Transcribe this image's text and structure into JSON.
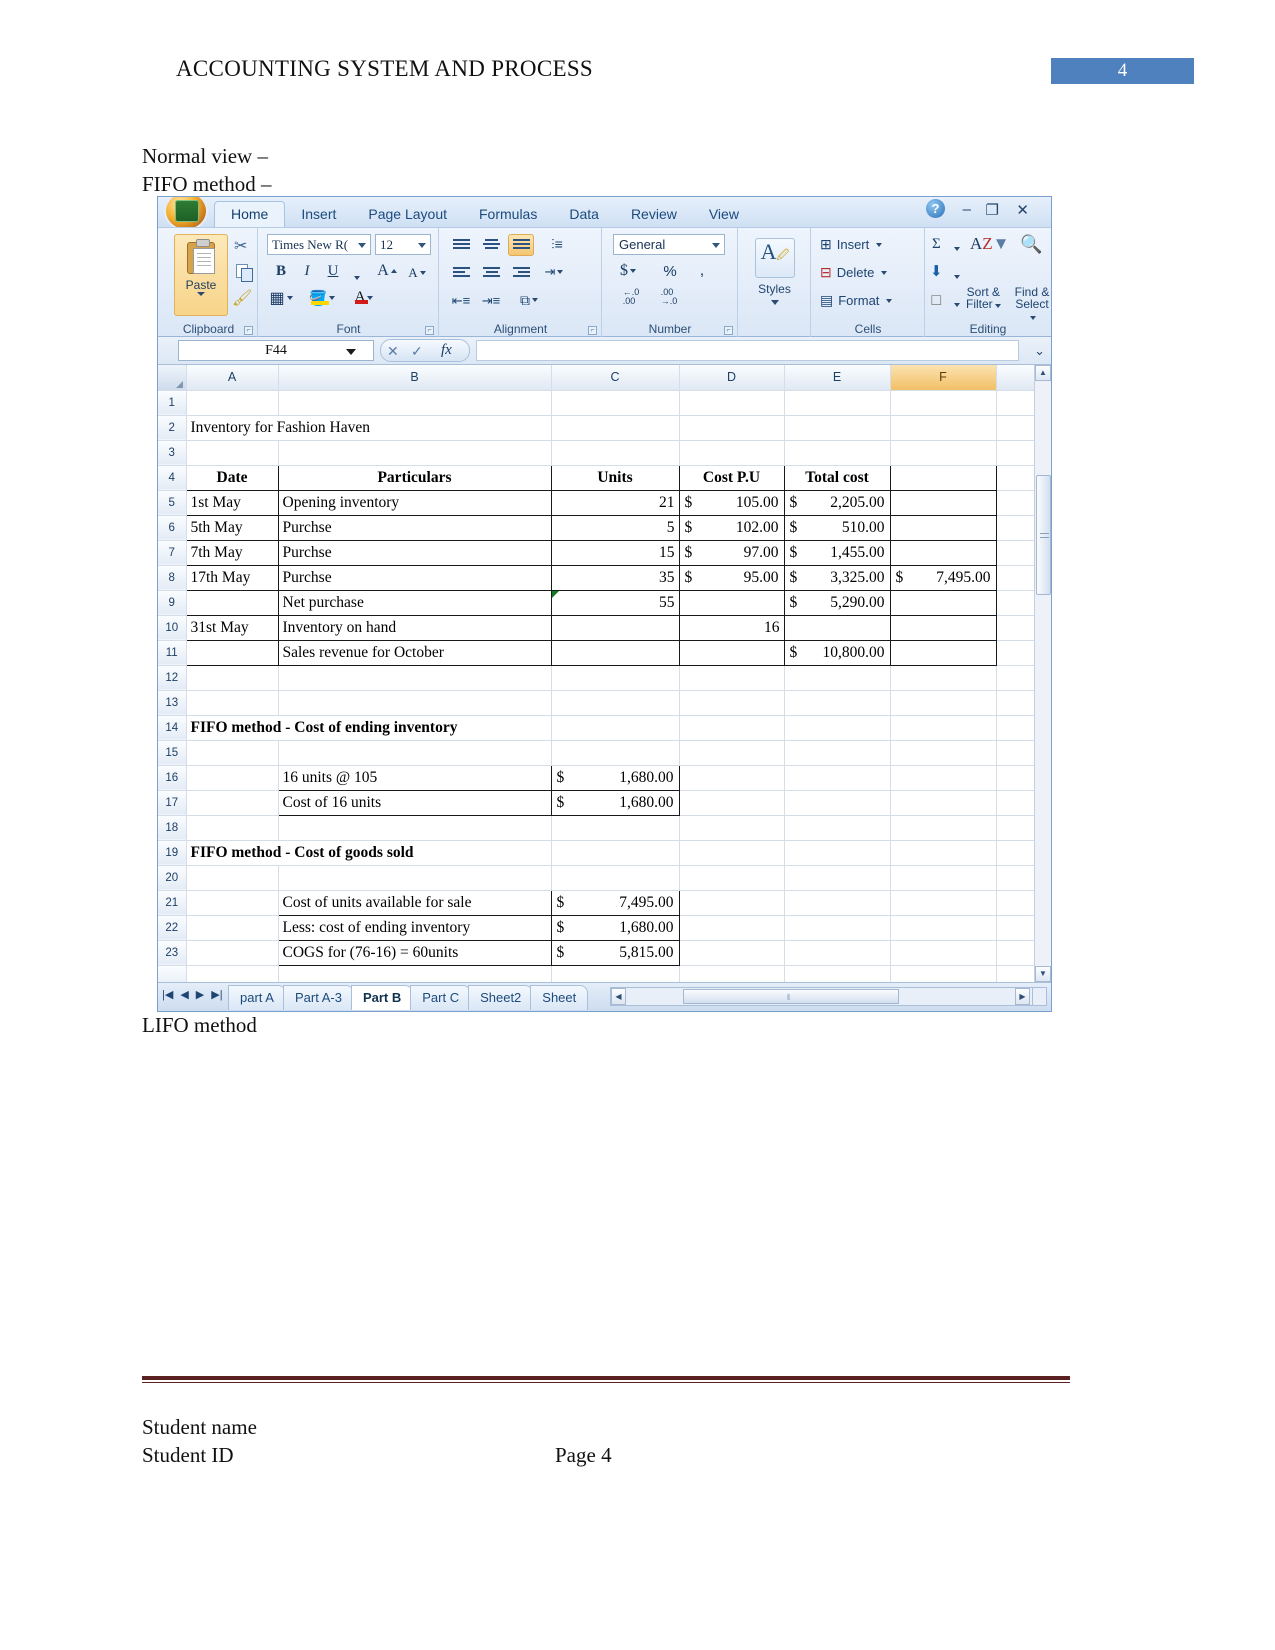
{
  "header": {
    "title": "ACCOUNTING SYSTEM AND PROCESS",
    "page_number": "4",
    "page_number_bg": "#4E81BD"
  },
  "body": {
    "caption_1": "Normal view –",
    "caption_2": "FIFO method –",
    "caption_3": "LIFO method"
  },
  "excel": {
    "ribbon_tabs": [
      {
        "label": "Home",
        "active": true
      },
      {
        "label": "Insert",
        "active": false
      },
      {
        "label": "Page Layout",
        "active": false
      },
      {
        "label": "Formulas",
        "active": false
      },
      {
        "label": "Data",
        "active": false
      },
      {
        "label": "Review",
        "active": false
      },
      {
        "label": "View",
        "active": false
      }
    ],
    "window_controls": {
      "help": "?",
      "minimize": "–",
      "maximize": "❐",
      "close": "✕"
    },
    "groups": {
      "clipboard": {
        "label": "Clipboard",
        "paste": "Paste",
        "cut": "✂",
        "copy": "copy",
        "format_painter": "format-painter"
      },
      "font": {
        "label": "Font",
        "font_name": "Times New R(",
        "font_size": "12",
        "bold": "B",
        "italic": "I",
        "underline": "U",
        "grow_font": "A",
        "shrink_font": "A"
      },
      "alignment": {
        "label": "Alignment"
      },
      "number": {
        "label": "Number",
        "format": "General",
        "currency": "$",
        "percent": "%",
        "comma": ",",
        "increase_decimal": ".00",
        "decrease_decimal": ".0"
      },
      "styles": {
        "label": "Styles",
        "button": "Styles"
      },
      "cells": {
        "label": "Cells",
        "insert": "Insert",
        "delete": "Delete",
        "format": "Format"
      },
      "editing": {
        "label": "Editing",
        "autosum": "Σ",
        "sort_filter": "Sort &\nFilter",
        "sort_filter_l1": "Sort &",
        "sort_filter_l2": "Filter",
        "find_select_l1": "Find &",
        "find_select_l2": "Select"
      }
    },
    "formula_bar": {
      "name_box": "F44",
      "fx_label": "fx",
      "formula_value": ""
    },
    "grid": {
      "column_headers": [
        "A",
        "B",
        "C",
        "D",
        "E",
        "F"
      ],
      "selected_column": "F",
      "rows": [
        {
          "n": "1",
          "a": "",
          "b": "",
          "c": "",
          "d": "",
          "e": "",
          "f": ""
        },
        {
          "n": "2",
          "a": "Inventory for Fashion Haven",
          "b": "",
          "c": "",
          "d": "",
          "e": "",
          "f": ""
        },
        {
          "n": "3",
          "a": "",
          "b": "",
          "c": "",
          "d": "",
          "e": "",
          "f": ""
        },
        {
          "n": "4",
          "a": "Date",
          "b": "Particulars",
          "c": "Units",
          "d": "Cost P.U",
          "e": "Total cost",
          "f": ""
        },
        {
          "n": "5",
          "a": "1st May",
          "b": "Opening inventory",
          "c": "21",
          "d": "105.00",
          "e": "2,205.00",
          "f": ""
        },
        {
          "n": "6",
          "a": "5th May",
          "b": "Purchse",
          "c": "5",
          "d": "102.00",
          "e": "510.00",
          "f": ""
        },
        {
          "n": "7",
          "a": "7th May",
          "b": "Purchse",
          "c": "15",
          "d": "97.00",
          "e": "1,455.00",
          "f": ""
        },
        {
          "n": "8",
          "a": "17th May",
          "b": "Purchse",
          "c": "35",
          "d": "95.00",
          "e": "3,325.00",
          "f": "7,495.00"
        },
        {
          "n": "9",
          "a": "",
          "b": "Net purchase",
          "c": "55",
          "d": "",
          "e": "5,290.00",
          "f": ""
        },
        {
          "n": "10",
          "a": "31st May",
          "b": "Inventory on hand",
          "c": "",
          "d": "16",
          "e": "",
          "f": ""
        },
        {
          "n": "11",
          "a": "",
          "b": "Sales revenue for October",
          "c": "",
          "d": "",
          "e": "10,800.00",
          "f": ""
        },
        {
          "n": "12",
          "a": "",
          "b": "",
          "c": "",
          "d": "",
          "e": "",
          "f": ""
        },
        {
          "n": "13",
          "a": "",
          "b": "",
          "c": "",
          "d": "",
          "e": "",
          "f": ""
        },
        {
          "n": "14",
          "a": "FIFO method - Cost of ending inventory",
          "b": "",
          "c": "",
          "d": "",
          "e": "",
          "f": ""
        },
        {
          "n": "15",
          "a": "",
          "b": "",
          "c": "",
          "d": "",
          "e": "",
          "f": ""
        },
        {
          "n": "16",
          "a": "",
          "b": "16 units @ 105",
          "c": "1,680.00",
          "d": "",
          "e": "",
          "f": ""
        },
        {
          "n": "17",
          "a": "",
          "b": "Cost of 16 units",
          "c": "1,680.00",
          "d": "",
          "e": "",
          "f": ""
        },
        {
          "n": "18",
          "a": "",
          "b": "",
          "c": "",
          "d": "",
          "e": "",
          "f": ""
        },
        {
          "n": "19",
          "a": "FIFO method - Cost of goods sold",
          "b": "",
          "c": "",
          "d": "",
          "e": "",
          "f": ""
        },
        {
          "n": "20",
          "a": "",
          "b": "",
          "c": "",
          "d": "",
          "e": "",
          "f": ""
        },
        {
          "n": "21",
          "a": "",
          "b": "Cost of units available for sale",
          "c": "7,495.00",
          "d": "",
          "e": "",
          "f": ""
        },
        {
          "n": "22",
          "a": "",
          "b": "Less: cost of ending inventory",
          "c": "1,680.00",
          "d": "",
          "e": "",
          "f": ""
        },
        {
          "n": "23",
          "a": "",
          "b": "COGS for  (76-16) = 60units",
          "c": "5,815.00",
          "d": "",
          "e": "",
          "f": ""
        }
      ],
      "currency_symbol": "$"
    },
    "sheet_tabs": [
      {
        "label": "part A",
        "active": false
      },
      {
        "label": "Part A-3",
        "active": false
      },
      {
        "label": "Part B",
        "active": true
      },
      {
        "label": "Part C",
        "active": false
      },
      {
        "label": "Sheet2",
        "active": false
      },
      {
        "label": "Sheet",
        "active": false
      }
    ]
  },
  "footer": {
    "student_name": "Student name",
    "student_id": "Student ID",
    "page_label": "Page 4",
    "rule_color": "#5B2020"
  }
}
